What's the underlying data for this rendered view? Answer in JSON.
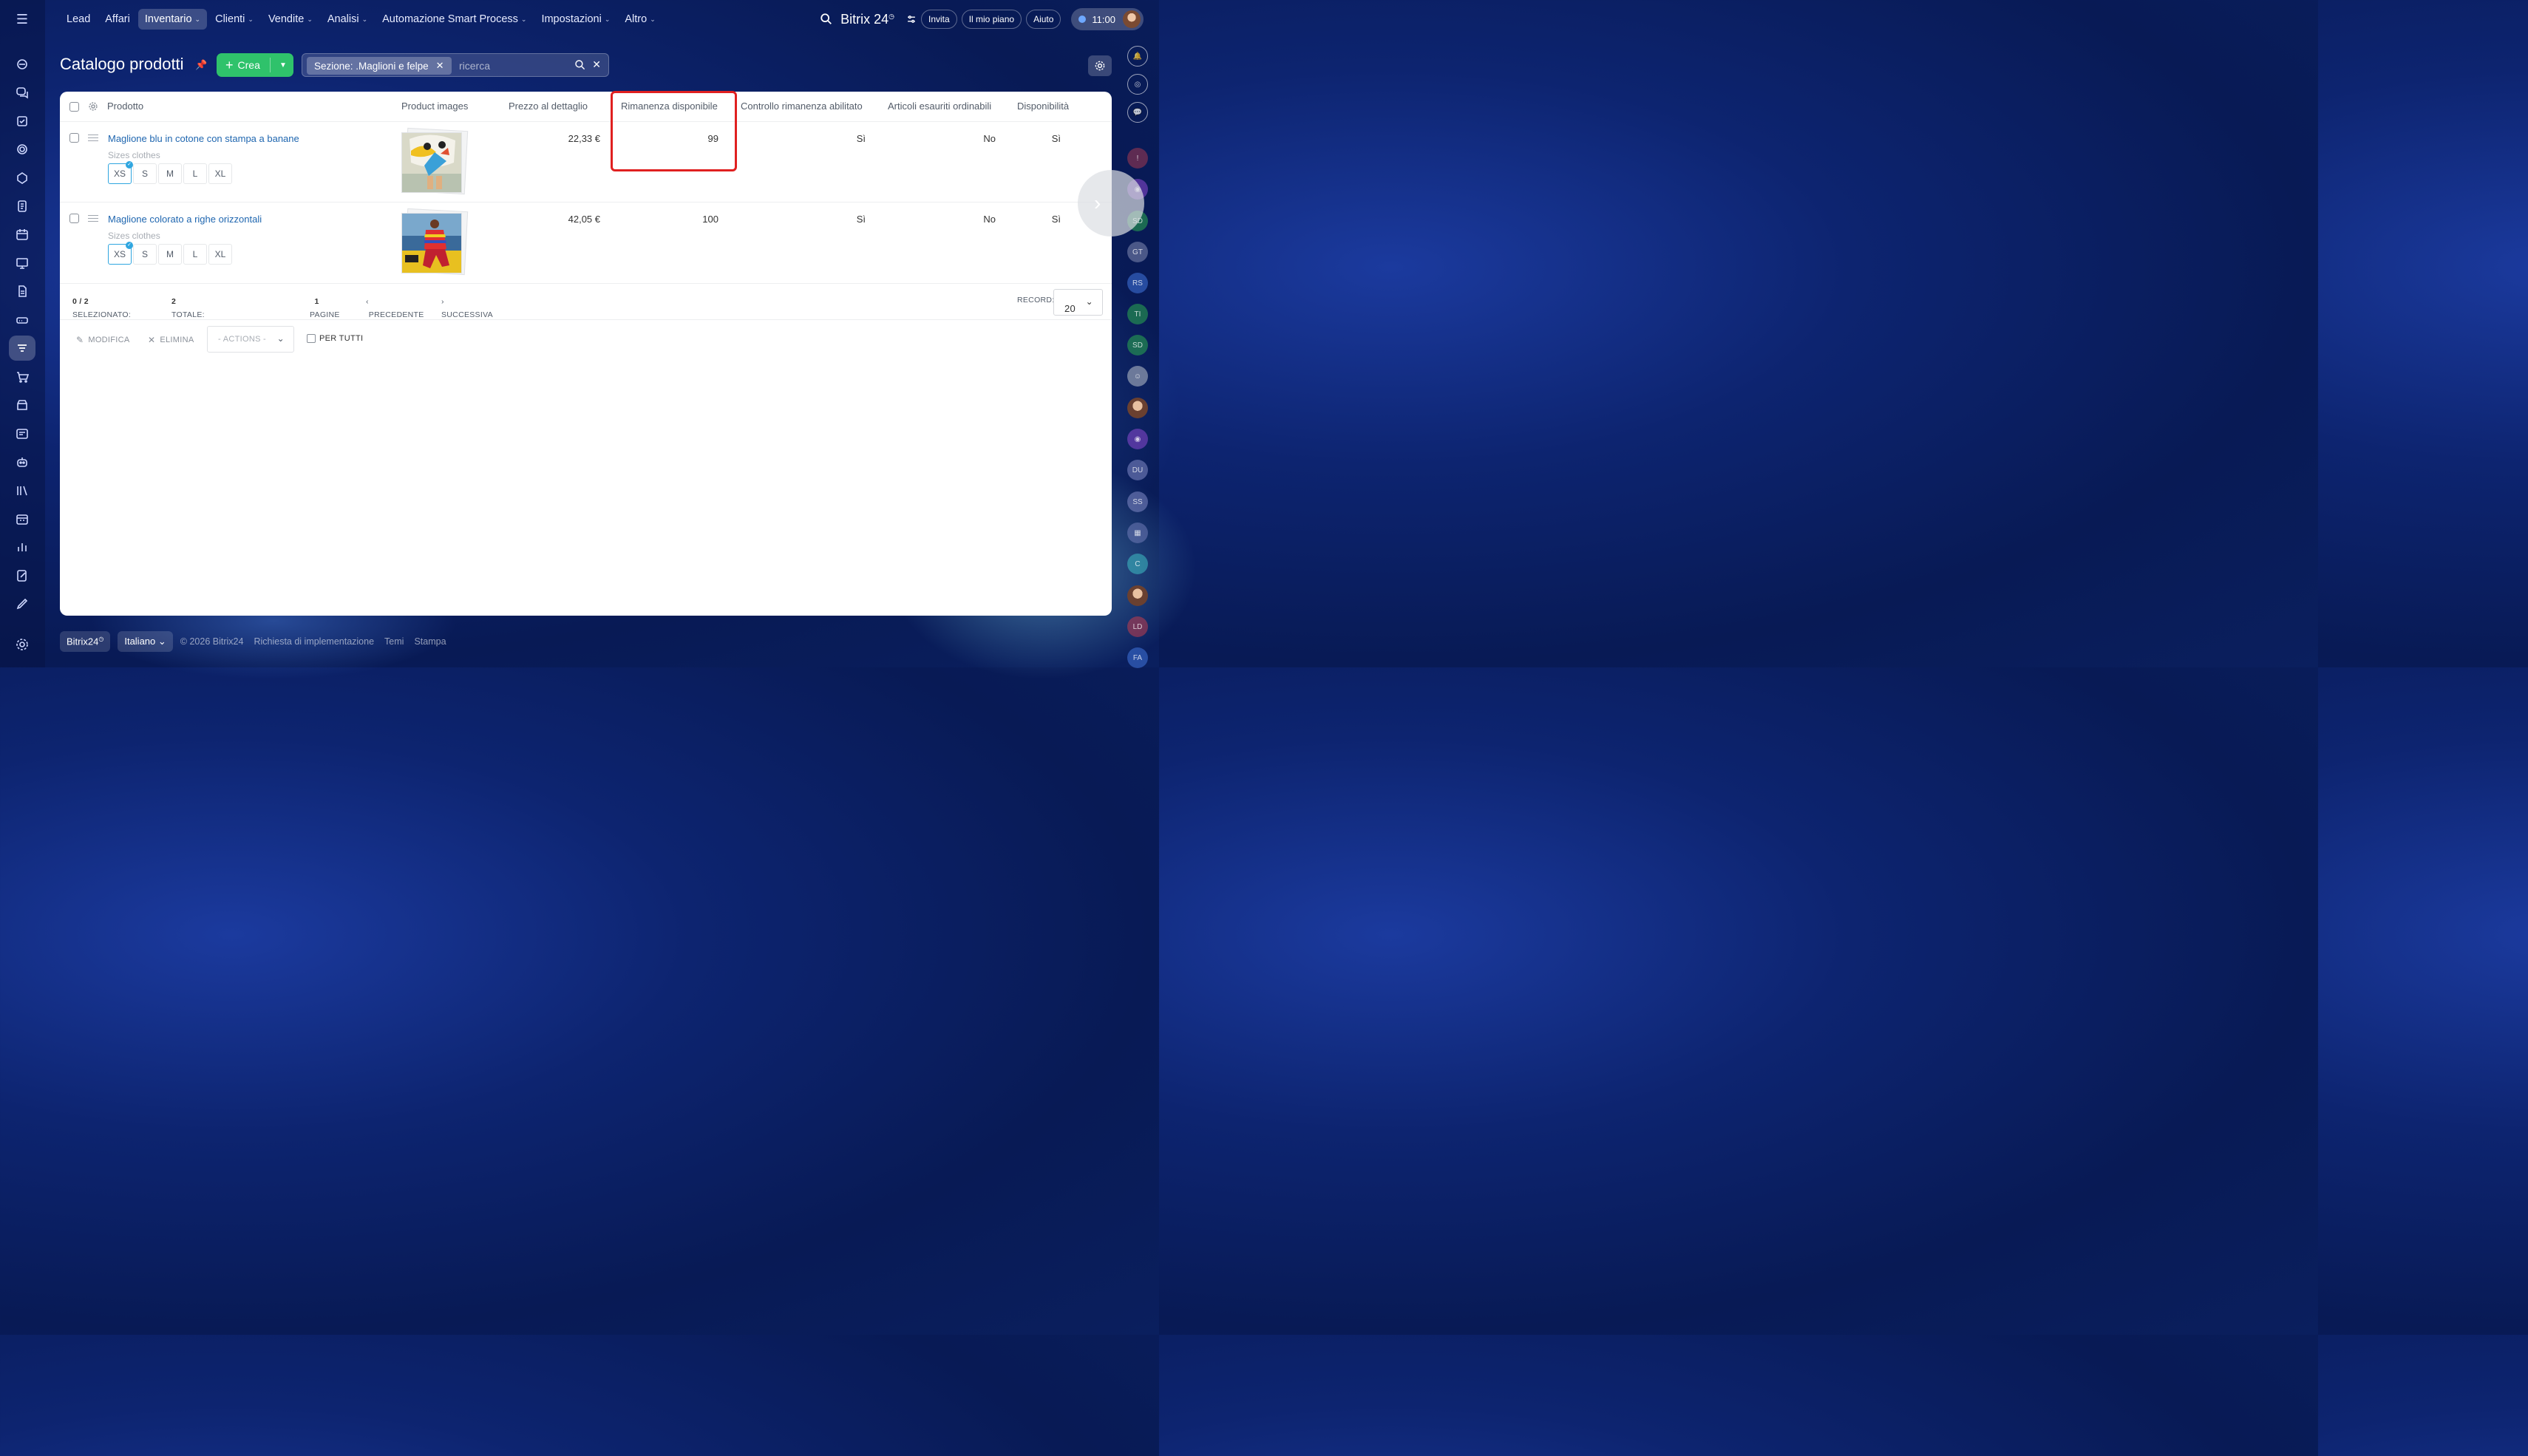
{
  "topnav": {
    "items": [
      {
        "label": "Lead",
        "has_menu": false,
        "active": false
      },
      {
        "label": "Affari",
        "has_menu": false,
        "active": false
      },
      {
        "label": "Inventario",
        "has_menu": true,
        "active": true
      },
      {
        "label": "Clienti",
        "has_menu": true,
        "active": false
      },
      {
        "label": "Vendite",
        "has_menu": true,
        "active": false
      },
      {
        "label": "Analisi",
        "has_menu": true,
        "active": false
      },
      {
        "label": "Automazione Smart Process",
        "has_menu": true,
        "active": false
      },
      {
        "label": "Impostazioni",
        "has_menu": true,
        "active": false
      },
      {
        "label": "Altro",
        "has_menu": true,
        "active": false
      }
    ],
    "brand": "Bitrix 24",
    "invite": "Invita",
    "plan": "Il mio piano",
    "help": "Aiuto",
    "time": "11:00"
  },
  "page": {
    "title": "Catalogo prodotti",
    "create_button": "Crea",
    "filter_tag": "Sezione: .Maglioni e felpe",
    "search_placeholder": "ricerca"
  },
  "table": {
    "headers": {
      "product": "Prodotto",
      "images": "Product images",
      "price": "Prezzo al dettaglio",
      "stock": "Rimanenza disponibile",
      "stock_control": "Controllo rimanenza abilitato",
      "backorder": "Articoli esauriti ordinabili",
      "availability": "Disponibilità"
    },
    "rows": [
      {
        "name": "Maglione blu in cotone con stampa a banane",
        "variation_label": "Sizes clothes",
        "sizes": [
          "XS",
          "S",
          "M",
          "L",
          "XL"
        ],
        "selected_size": "XS",
        "price": "22,33 €",
        "stock": "99",
        "stock_control": "Sì",
        "backorder": "No",
        "availability": "Sì"
      },
      {
        "name": "Maglione colorato a righe orizzontali",
        "variation_label": "Sizes clothes",
        "sizes": [
          "XS",
          "S",
          "M",
          "L",
          "XL"
        ],
        "selected_size": "XS",
        "price": "42,05 €",
        "stock": "100",
        "stock_control": "Sì",
        "backorder": "No",
        "availability": "Sì"
      }
    ]
  },
  "pager": {
    "selected_label": "SELEZIONATO:",
    "selected_value": "0 / 2",
    "total_label": "TOTALE:",
    "total_value": "2",
    "pages_label": "PAGINE",
    "current_page": "1",
    "prev": "PRECEDENTE",
    "next": "SUCCESSIVA",
    "records_label": "RECORD:",
    "records_value": "20"
  },
  "actions": {
    "edit": "MODIFICA",
    "delete": "ELIMINA",
    "select": "- ACTIONS -",
    "for_all": "PER TUTTI"
  },
  "footer": {
    "brand": "Bitrix24",
    "language": "Italiano",
    "copyright": "© 2026 Bitrix24",
    "implementation": "Richiesta di implementazione",
    "themes": "Temi",
    "print": "Stampa"
  },
  "right_bar": {
    "avatars": [
      "SD",
      "GT",
      "RS",
      "TI",
      "SD",
      "DU",
      "SS",
      "C",
      "LD",
      "FA"
    ]
  },
  "colors": {
    "accent_green": "#2fc26b",
    "link_blue": "#2067b0",
    "highlight_red": "#e02020",
    "selected_size_border": "#2fa6e0"
  }
}
